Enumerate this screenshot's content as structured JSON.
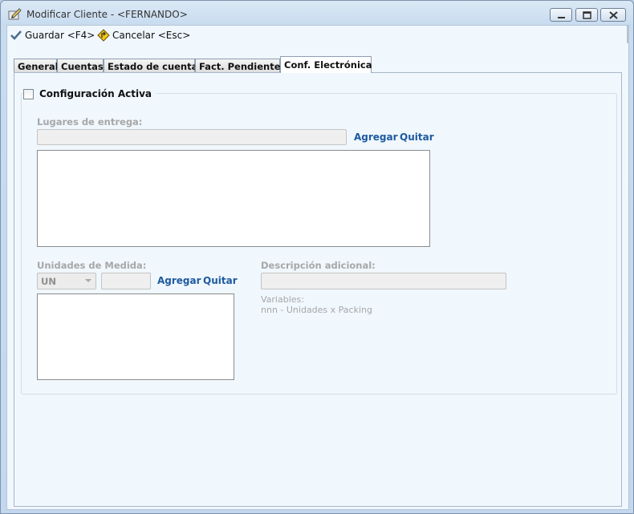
{
  "window": {
    "title": "Modificar Cliente - <FERNANDO>"
  },
  "toolbar": {
    "save_label": "Guardar <F4>",
    "cancel_label": "Cancelar <Esc>"
  },
  "tabs": [
    {
      "label": "General"
    },
    {
      "label": "Cuentas"
    },
    {
      "label": "Estado de cuenta"
    },
    {
      "label": "Fact. Pendientes"
    },
    {
      "label": "Conf. Electrónica"
    }
  ],
  "active_tab": "Conf. Electrónica",
  "config": {
    "active_label": "Configuración Activa",
    "active_checked": false,
    "delivery_label": "Lugares de entrega:",
    "delivery_value": "",
    "delivery_add": "Agregar",
    "delivery_remove": "Quitar",
    "units_label": "Unidades de Medida:",
    "units_selected": "UN",
    "units_qty_value": "",
    "units_add": "Agregar",
    "units_remove": "Quitar",
    "desc_label": "Descripción adicional:",
    "desc_value": "",
    "variables_title": "Variables:",
    "variables_line": "nnn - Unidades x Packing"
  },
  "colors": {
    "link": "#1d5aa0",
    "disabled_text": "#a7a7a7",
    "panel_bg": "#f0f7fd"
  }
}
